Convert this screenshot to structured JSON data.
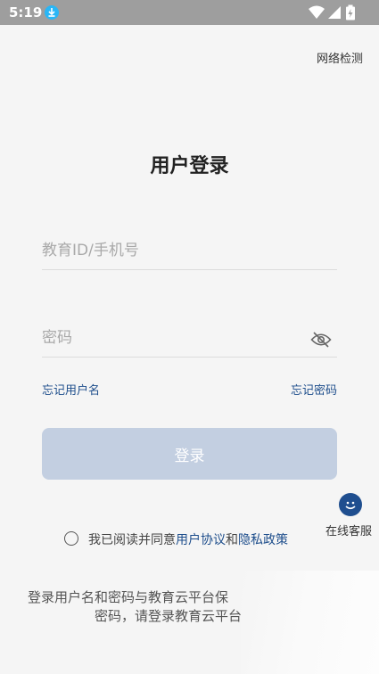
{
  "status_bar": {
    "time": "5:19"
  },
  "header": {
    "network_check": "网络检测"
  },
  "title": "用户登录",
  "form": {
    "account_placeholder": "教育ID/手机号",
    "password_placeholder": "密码",
    "forgot_username": "忘记用户名",
    "forgot_password": "忘记密码",
    "login_label": "登录"
  },
  "agreement": {
    "prefix": "我已阅读并同意",
    "user_agreement": "用户协议",
    "and": "和",
    "privacy_policy": "隐私政策"
  },
  "customer_service": {
    "label": "在线客服"
  },
  "notice": {
    "line1": "登录用户名和密码与教育云平台保",
    "line2": "密码，请登录教育云平台"
  },
  "colors": {
    "accent": "#1e4e8c",
    "button_disabled": "#c3cfe1",
    "status_bar": "#9e9e9e"
  }
}
